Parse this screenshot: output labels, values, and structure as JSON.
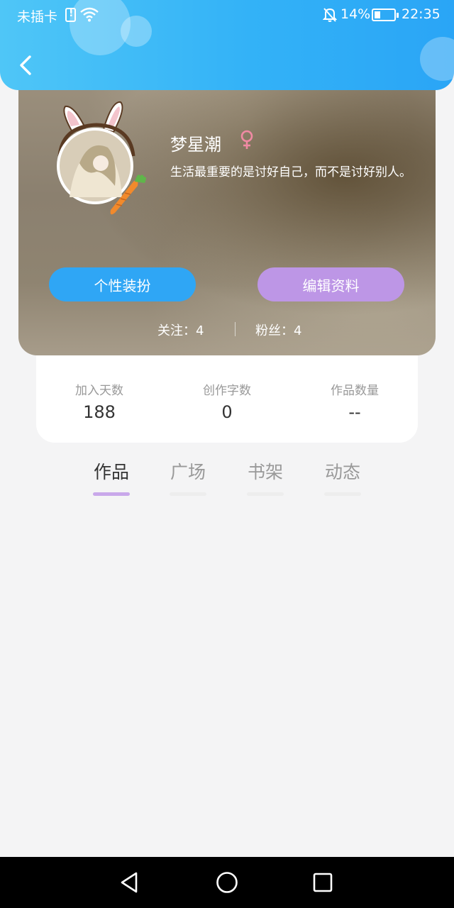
{
  "status_bar": {
    "carrier": "未插卡",
    "battery": "14%",
    "time": "22:35",
    "icons": [
      "sim-alert-icon",
      "wifi-icon",
      "mute-bell-icon",
      "battery-charging-icon"
    ]
  },
  "header": {
    "back_icon": "chevron-left-icon",
    "color_start": "#4fc6f7",
    "color_end": "#2aa5f6"
  },
  "profile": {
    "name": "梦星潮",
    "gender_icon": "female-icon",
    "gender_color": "#f08aa4",
    "signature": "生活最重要的是讨好自己，而不是讨好别人。",
    "dress_button": "个性装扮",
    "edit_button": "编辑资料",
    "following": "关注：4",
    "fans": "粉丝：4"
  },
  "stats": [
    {
      "label": "加入天数",
      "value": "188"
    },
    {
      "label": "创作字数",
      "value": "0"
    },
    {
      "label": "作品数量",
      "value": "--"
    }
  ],
  "tabs": [
    {
      "label": "作品",
      "active": true
    },
    {
      "label": "广场",
      "active": false
    },
    {
      "label": "书架",
      "active": false
    },
    {
      "label": "动态",
      "active": false
    }
  ],
  "nav": {
    "back": "triangle-back-icon",
    "home": "circle-home-icon",
    "recent": "square-recent-icon"
  },
  "colors": {
    "primary_blue": "#2fa6f5",
    "accent_purple": "#bd96e6",
    "active_underline": "#c9a8ea",
    "background": "#f4f4f5"
  }
}
